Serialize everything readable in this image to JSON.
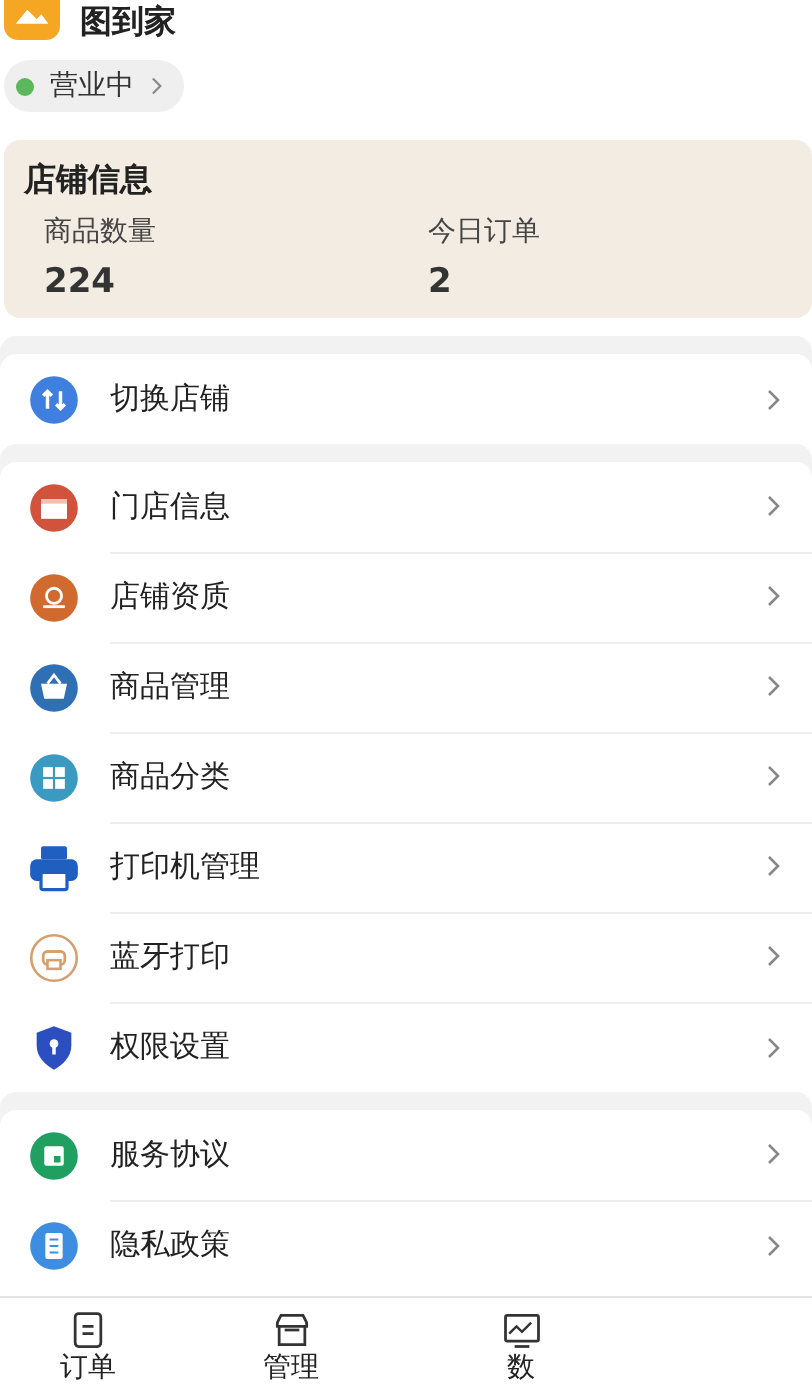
{
  "app": {
    "title": "图到家"
  },
  "status": {
    "label": "营业中",
    "color": "#5cb85c"
  },
  "store_info": {
    "title": "店铺信息",
    "stats": [
      {
        "label": "商品数量",
        "value": "224"
      },
      {
        "label": "今日订单",
        "value": "2"
      }
    ]
  },
  "menu_groups": [
    [
      {
        "label": "切换店铺"
      }
    ],
    [
      {
        "label": "门店信息"
      },
      {
        "label": "店铺资质"
      },
      {
        "label": "商品管理"
      },
      {
        "label": "商品分类"
      },
      {
        "label": "打印机管理"
      },
      {
        "label": "蓝牙打印"
      },
      {
        "label": "权限设置"
      }
    ],
    [
      {
        "label": "服务协议"
      },
      {
        "label": "隐私政策"
      }
    ]
  ],
  "tab_bar": [
    {
      "label": "订单"
    },
    {
      "label": "管理"
    },
    {
      "label": "数"
    }
  ]
}
